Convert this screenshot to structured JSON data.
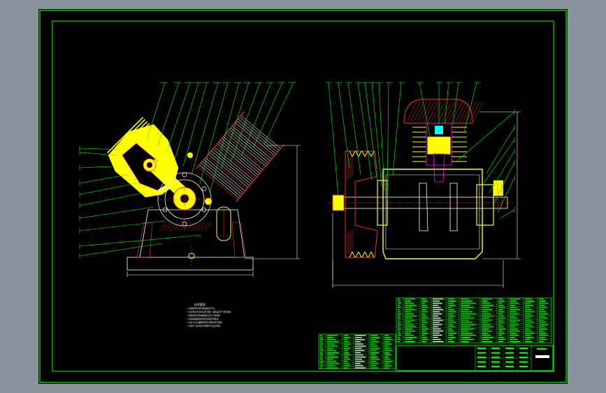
{
  "colors": {
    "viewer_bg": "#8a929c",
    "sheet_bg": "#000000",
    "border": "#00ff00",
    "leader": "#00ff00",
    "dimension": "#ffffff",
    "part_fill": "#ffff00",
    "hatch": "#ff3030",
    "fins": "#e8e8e8",
    "inner_lines": "#ff00ff",
    "title_text": "#00ff00"
  },
  "notes": {
    "title": "技术要求",
    "lines": [
      "1.装配前所有零件用煤油清洗干净。",
      "2.各密封处不允许有漏气现象，装配后进行气密性试验。",
      "3.装配后用手转动曲轴应灵活无卡滞现象。",
      "4.各运动副装配前应加注适量的润滑油。",
      "5.连杆大头与曲柄销的配合间隙应符合要求。",
      "6.活塞与气缸的配合间隙应符合设计要求。"
    ]
  }
}
